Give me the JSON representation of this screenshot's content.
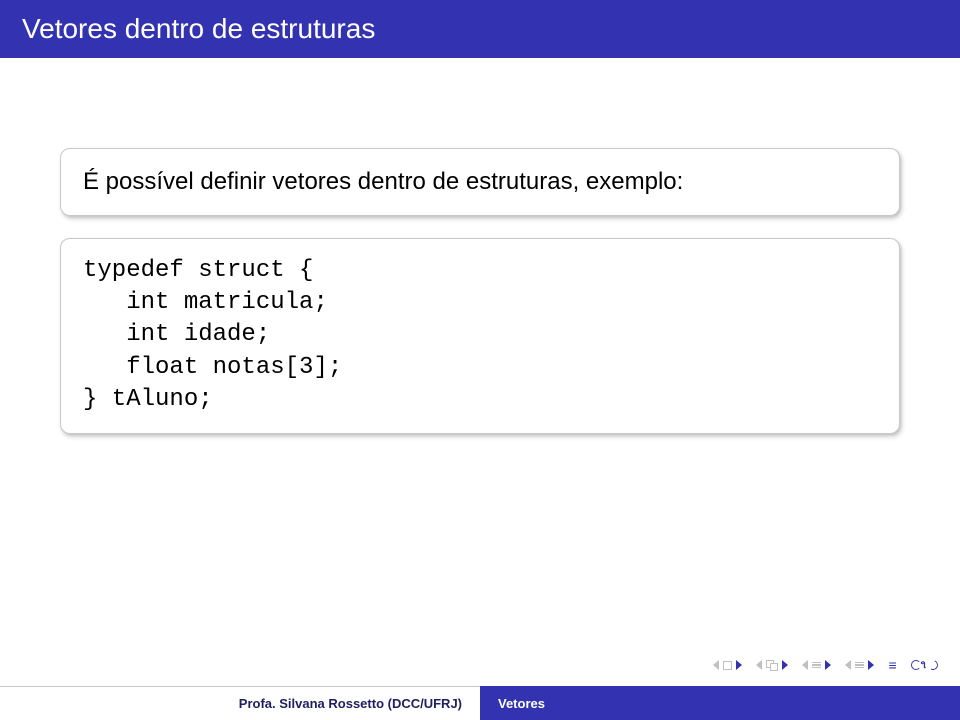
{
  "title": "Vetores dentro de estruturas",
  "body_text": "É possível definir vetores dentro de estruturas, exemplo:",
  "code_lines": [
    "typedef struct {",
    "   int matricula;",
    "   int idade;",
    "   float notas[3];",
    "} tAluno;"
  ],
  "footer": {
    "author": "Profa. Silvana Rossetto (DCC/UFRJ)",
    "short_title": "Vetores"
  }
}
